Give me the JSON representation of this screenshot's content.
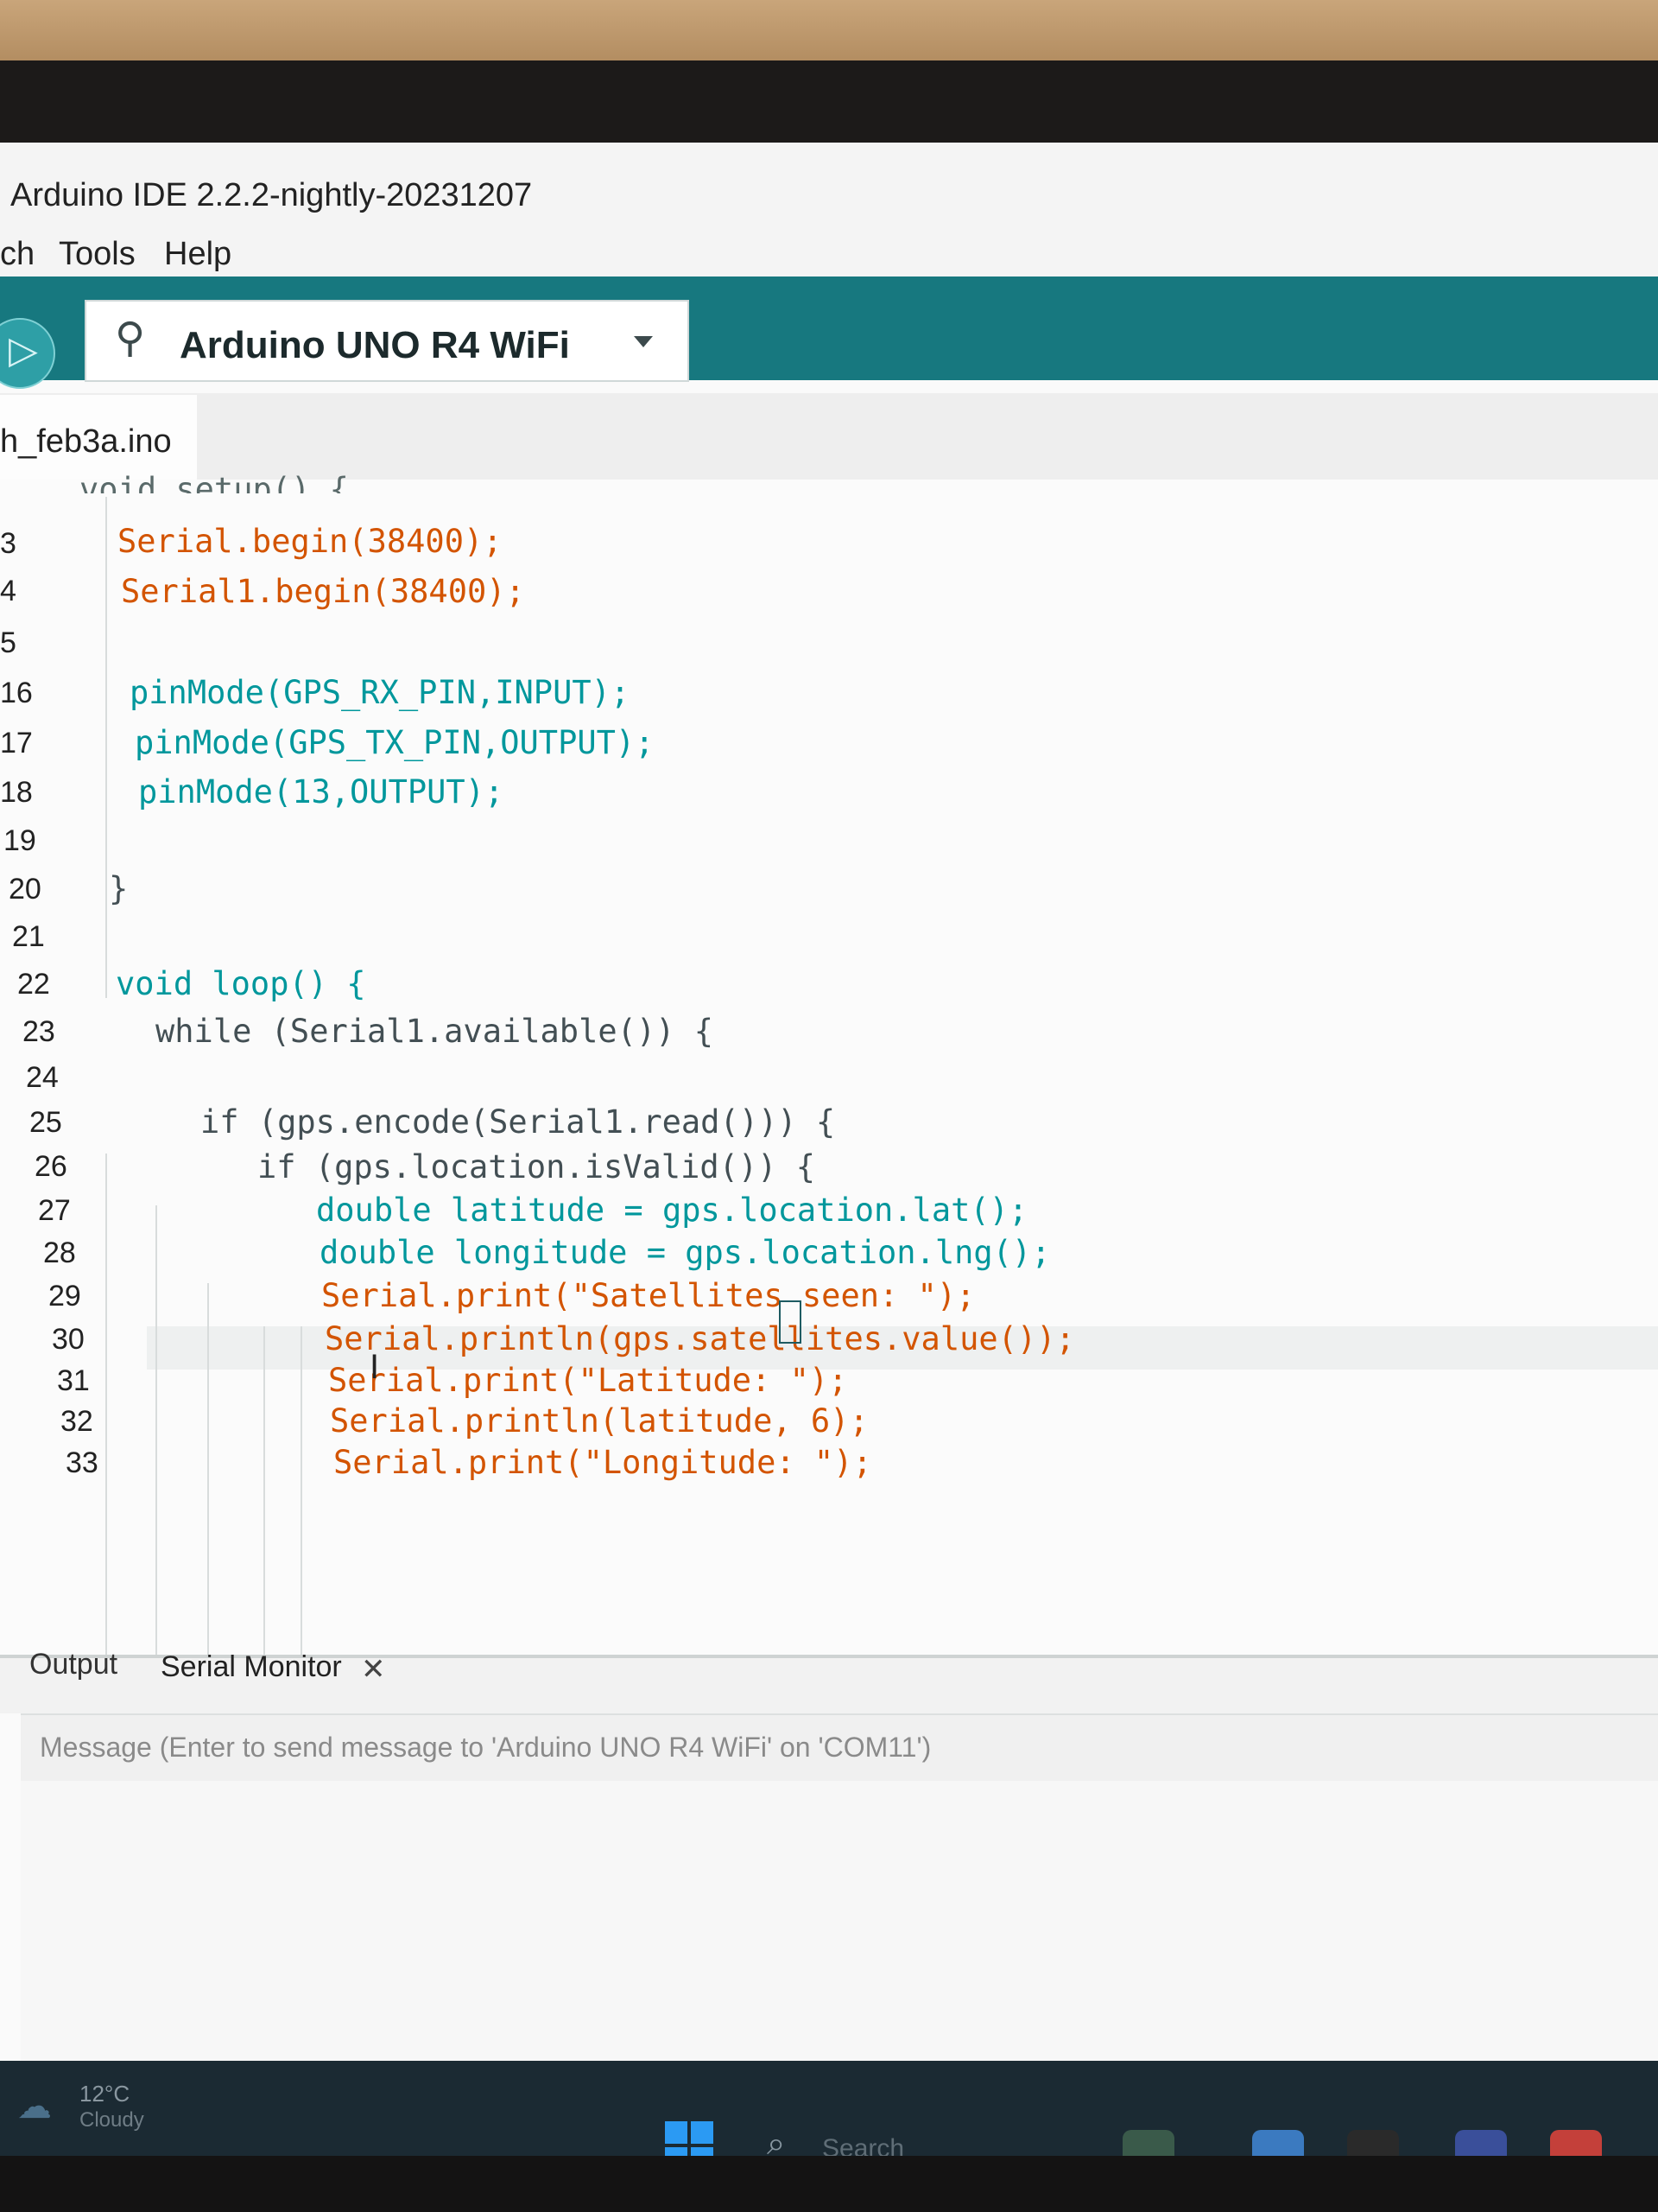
{
  "window": {
    "title": "Arduino IDE 2.2.2-nightly-20231207"
  },
  "menu": [
    "ch",
    "Tools",
    "Help"
  ],
  "toolbar": {
    "board": "Arduino UNO R4 WiFi"
  },
  "editor": {
    "tab_label": "h_feb3a.ino",
    "partial_line": "void setup() {",
    "lines": [
      {
        "num": "3",
        "text": "Serial.begin(38400);"
      },
      {
        "num": "4",
        "text": "Serial1.begin(38400);"
      },
      {
        "num": "5",
        "text": ""
      },
      {
        "num": "16",
        "text": "pinMode(GPS_RX_PIN,INPUT);"
      },
      {
        "num": "17",
        "text": "pinMode(GPS_TX_PIN,OUTPUT);"
      },
      {
        "num": "18",
        "text": "pinMode(13,OUTPUT);"
      },
      {
        "num": "19",
        "text": ""
      },
      {
        "num": "20",
        "text": "}"
      },
      {
        "num": "21",
        "text": ""
      },
      {
        "num": "22",
        "text": "void loop() {"
      },
      {
        "num": "23",
        "text": "while (Serial1.available()) {"
      },
      {
        "num": "24",
        "text": ""
      },
      {
        "num": "25",
        "text": "if (gps.encode(Serial1.read())) {"
      },
      {
        "num": "26",
        "text": "if (gps.location.isValid()) {"
      },
      {
        "num": "27",
        "text": "double latitude = gps.location.lat();"
      },
      {
        "num": "28",
        "text": "double longitude = gps.location.lng();"
      },
      {
        "num": "29",
        "text": "Serial.print(\"Satellites seen: \");"
      },
      {
        "num": "30",
        "text": "Serial.println(gps.satellites.value());"
      },
      {
        "num": "31",
        "text": "Serial.print(\"Latitude: \");"
      },
      {
        "num": "32",
        "text": "Serial.println(latitude, 6);"
      },
      {
        "num": "33",
        "text": "Serial.print(\"Longitude: \");"
      }
    ]
  },
  "bottom_panel": {
    "tabs": {
      "output": "Output",
      "serial_monitor": "Serial Monitor"
    },
    "message_placeholder": "Message (Enter to send message to 'Arduino UNO R4 WiFi' on 'COM11')"
  },
  "taskbar": {
    "weather_temp": "12°C",
    "weather_desc": "Cloudy",
    "search_label": "Search"
  },
  "colors": {
    "toolbar": "#17787f",
    "keyword": "#00979c",
    "serial_object": "#d35400"
  }
}
